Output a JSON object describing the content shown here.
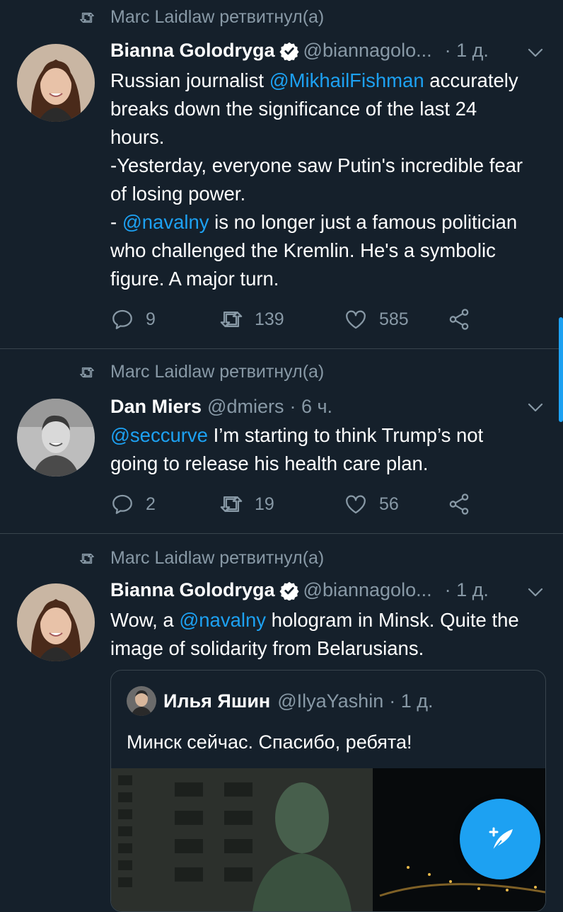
{
  "tweets": [
    {
      "retweeted_by": "Marc Laidlaw ретвитнул(а)",
      "name": "Bianna Golodryga",
      "handle": "@biannagolo...",
      "time": "· 1 д.",
      "text_parts": [
        "Russian journalist ",
        "@MikhailFishman",
        " accurately breaks down the significance of the last 24 hours.",
        "-Yesterday, everyone saw Putin's incredible fear of losing power.",
        "- ",
        "@navalny",
        " is no longer just a famous politician who challenged the Kremlin. He's a symbolic figure. A major turn."
      ],
      "replies": "9",
      "retweets": "139",
      "likes": "585"
    },
    {
      "retweeted_by": "Marc Laidlaw ретвитнул(а)",
      "name": "Dan Miers",
      "handle": "@dmiers",
      "time": "· 6 ч.",
      "text_parts": [
        "@seccurve",
        " I’m starting to think Trump’s not going to release his health care plan."
      ],
      "replies": "2",
      "retweets": "19",
      "likes": "56"
    },
    {
      "retweeted_by": "Marc Laidlaw ретвитнул(а)",
      "name": "Bianna Golodryga",
      "handle": "@biannagolo...",
      "time": "· 1 д.",
      "text_parts": [
        "Wow, a ",
        "@navalny",
        " hologram in Minsk. Quite the image of solidarity from Belarusians."
      ],
      "quote": {
        "name": "Илья Яшин",
        "handle": "@IlyaYashin",
        "time": "· 1 д.",
        "text": "Минск сейчас. Спасибо, ребята!"
      }
    }
  ],
  "colors": {
    "background": "#15202b",
    "accent": "#1da1f2",
    "muted": "#8899a6",
    "divider": "#38444d"
  },
  "icons": [
    "retweet-icon",
    "verified-badge-icon",
    "chevron-down-icon",
    "reply-icon",
    "like-icon",
    "share-icon",
    "compose-tweet-icon"
  ]
}
